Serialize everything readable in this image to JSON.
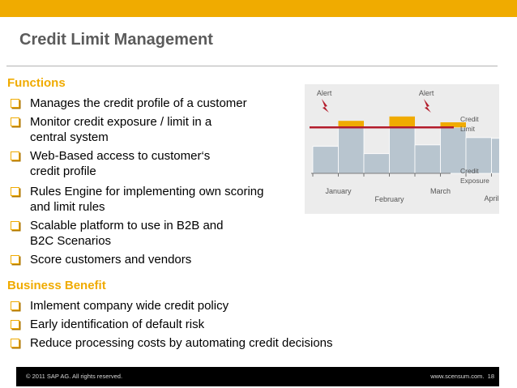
{
  "colors": {
    "accent": "#f0ab00",
    "gray_bar": "#b8c5cf",
    "limit_line": "#b31c2c",
    "chart_bg": "#ececec"
  },
  "slide": {
    "title": "Credit Limit Management"
  },
  "functions": {
    "heading": "Functions",
    "items": [
      {
        "lines": [
          "Manages the credit profile of a customer"
        ]
      },
      {
        "lines": [
          "Monitor credit exposure / limit in a",
          "central system"
        ]
      },
      {
        "lines": [
          "Web-Based access to customer‘s",
          "credit profile"
        ]
      },
      {
        "lines": [
          "Rules Engine for implementing own scoring",
          "and limit rules"
        ]
      },
      {
        "lines": [
          "Scalable platform to use in B2B and",
          "B2C Scenarios"
        ]
      },
      {
        "lines": [
          "Score customers and vendors"
        ]
      }
    ]
  },
  "business": {
    "heading": "Business Benefit",
    "items": [
      {
        "lines": [
          "Imlement company wide credit policy"
        ]
      },
      {
        "lines": [
          "Early identification of default risk"
        ]
      },
      {
        "lines": [
          "Reduce processing costs by automating credit decisions"
        ]
      }
    ]
  },
  "chart_data": {
    "type": "bar",
    "categories": [
      "January",
      "February",
      "March",
      "April"
    ],
    "credit_limit": 63,
    "ylim": [
      0,
      100
    ],
    "bars": [
      37,
      72,
      27,
      78,
      39,
      70,
      49,
      48
    ],
    "alerts": [
      {
        "label": "Alert",
        "category": "January"
      },
      {
        "label": "Alert",
        "category": "March"
      }
    ],
    "line_labels": {
      "limit": [
        "Credit",
        "Limit"
      ],
      "exposure": [
        "Credit",
        "Exposure"
      ]
    }
  },
  "footer": {
    "copyright": "© 2011 SAP AG. All rights reserved.",
    "url": "www.scensum.com.",
    "page": "18"
  }
}
